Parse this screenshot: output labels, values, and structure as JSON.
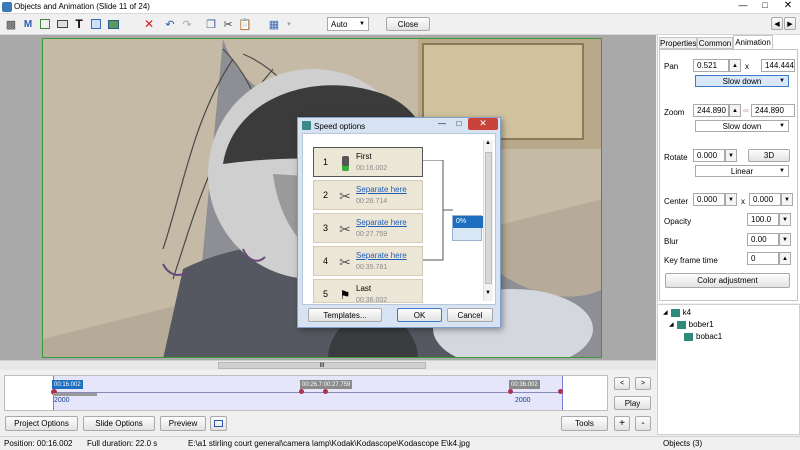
{
  "window": {
    "title": "Objects and Animation  (Slide 11 of 24)"
  },
  "toolbar": {
    "zoom_value": "Auto",
    "close_label": "Close"
  },
  "right_tabs": [
    "Properties",
    "Common",
    "Animation"
  ],
  "animation": {
    "pan_label": "Pan",
    "pan_x": "0.521",
    "pan_sep": "x",
    "pan_y": "144.444",
    "pan_speed": "Slow down",
    "zoom_label": "Zoom",
    "zoom_x": "244.890",
    "zoom_y": "244.890",
    "zoom_speed": "Slow down",
    "rotate_label": "Rotate",
    "rotate_value": "0.000",
    "btn_3d": "3D",
    "rotate_speed": "Linear",
    "center_label": "Center",
    "center_x": "0.000",
    "center_sep": "x",
    "center_y": "0.000",
    "opacity_label": "Opacity",
    "opacity_value": "100.0",
    "blur_label": "Blur",
    "blur_value": "0.00",
    "keyframe_time_label": "Key frame time",
    "keyframe_time_value": "0",
    "color_adjustment": "Color adjustment"
  },
  "tree": {
    "items": [
      "k4",
      "bober1",
      "bobac1"
    ]
  },
  "dialog": {
    "title": "Speed options",
    "keyframes": [
      {
        "num": "1",
        "name": "First",
        "time": "00:16.002"
      },
      {
        "num": "2",
        "name": "Separate here",
        "time": "00:26.714"
      },
      {
        "num": "3",
        "name": "Separate here",
        "time": "00:27.759"
      },
      {
        "num": "4",
        "name": "Separate here",
        "time": "00:35.781"
      },
      {
        "num": "5",
        "name": "Last",
        "time": "00:36.002"
      }
    ],
    "percent": "0%",
    "templates": "Templates...",
    "ok": "OK",
    "cancel": "Cancel"
  },
  "timeline": {
    "time_start": "00:16.002",
    "time_mid": "00:26.7:00:27.759",
    "time_end": "00:36.002",
    "val_left": "2000",
    "val_right": "2000",
    "play_label": "Play",
    "scroll_grip": "III"
  },
  "bottom": {
    "project_options": "Project Options",
    "slide_options": "Slide Options",
    "preview": "Preview",
    "tools": "Tools"
  },
  "status": {
    "position": "Position:  00:16.002",
    "duration": "Full duration:  22.0 s",
    "path": "E:\\a1 stirling court general\\camera lamp\\Kodak\\Kodascope\\Kodascope E\\k4.jpg",
    "objects": "Objects (3)"
  },
  "colors": {
    "accent_blue": "#1e6fbf",
    "dialog_border": "#7fa0c8",
    "keyframe_bg": "#ece6d6",
    "timeline_bg": "#e6e6fa"
  }
}
